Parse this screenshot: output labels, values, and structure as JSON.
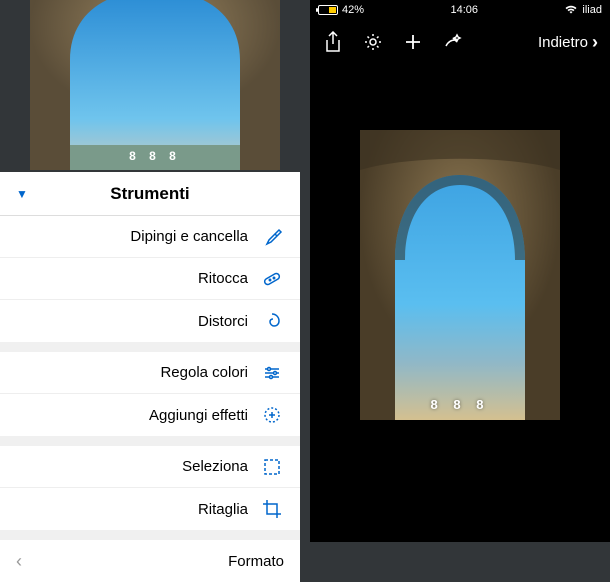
{
  "status_bar": {
    "battery_pct": "42%",
    "time": "14:06",
    "carrier": "iliad"
  },
  "toolbar": {
    "back_label": "Indietro"
  },
  "tools_sheet": {
    "title": "Strumenti",
    "group1": [
      {
        "label": "Dipingi e cancella",
        "icon": "brush-icon"
      },
      {
        "label": "Ritocca",
        "icon": "bandage-icon"
      },
      {
        "label": "Distorci",
        "icon": "swirl-icon"
      }
    ],
    "group2": [
      {
        "label": "Regola colori",
        "icon": "sliders-icon"
      },
      {
        "label": "Aggiungi effetti",
        "icon": "sparkle-icon"
      }
    ],
    "group3": [
      {
        "label": "Seleziona",
        "icon": "selection-icon"
      },
      {
        "label": "Ritaglia",
        "icon": "crop-icon"
      }
    ],
    "format_label": "Formato"
  },
  "watermark_text": "8 8 8"
}
